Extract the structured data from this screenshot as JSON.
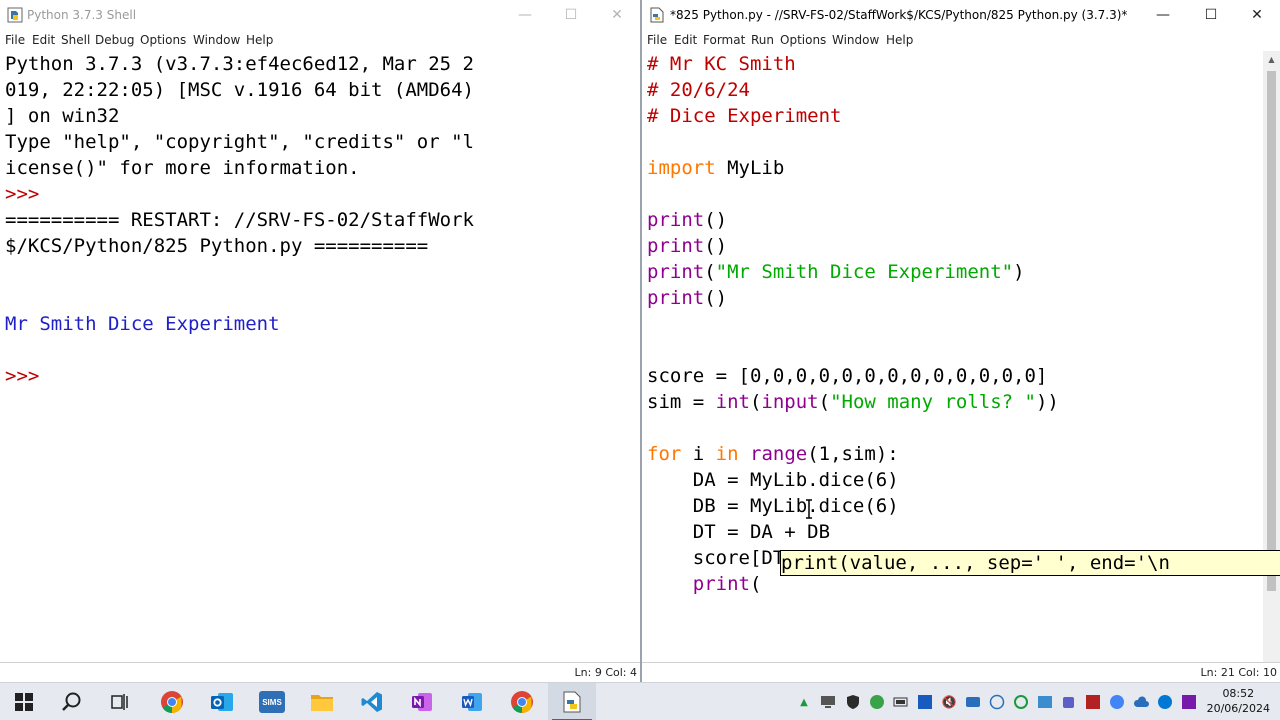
{
  "shell": {
    "title": "Python 3.7.3 Shell",
    "menu": [
      "File",
      "Edit",
      "Shell",
      "Debug",
      "Options",
      "Window",
      "Help"
    ],
    "lines": [
      {
        "text": "Python 3.7.3 (v3.7.3:ef4ec6ed12, Mar 25 2",
        "color": "black"
      },
      {
        "text": "019, 22:22:05) [MSC v.1916 64 bit (AMD64)",
        "color": "black"
      },
      {
        "text": "] on win32",
        "color": "black"
      },
      {
        "text": "Type \"help\", \"copyright\", \"credits\" or \"l",
        "color": "black"
      },
      {
        "text": "icense()\" for more information.",
        "color": "black"
      },
      {
        "text": ">>> ",
        "color": "red"
      },
      {
        "text": "========== RESTART: //SRV-FS-02/StaffWork",
        "color": "black"
      },
      {
        "text": "$/KCS/Python/825 Python.py ==========",
        "color": "black"
      },
      {
        "text": "",
        "color": "black"
      },
      {
        "text": "",
        "color": "black"
      },
      {
        "text": "Mr Smith Dice Experiment",
        "color": "blue"
      },
      {
        "text": "",
        "color": "black"
      },
      {
        "text": ">>> ",
        "color": "red"
      }
    ],
    "status": "Ln: 9  Col: 4"
  },
  "editor": {
    "title": "*825 Python.py - //SRV-FS-02/StaffWork$/KCS/Python/825 Python.py (3.7.3)*",
    "menu": [
      "File",
      "Edit",
      "Format",
      "Run",
      "Options",
      "Window",
      "Help"
    ],
    "lines": [
      [
        {
          "t": "# Mr KC Smith",
          "c": "red"
        }
      ],
      [
        {
          "t": "# 20/6/24",
          "c": "red"
        }
      ],
      [
        {
          "t": "# Dice Experiment",
          "c": "red"
        }
      ],
      [],
      [
        {
          "t": "import",
          "c": "orange"
        },
        {
          "t": " MyLib",
          "c": "black"
        }
      ],
      [],
      [
        {
          "t": "print",
          "c": "purple"
        },
        {
          "t": "()",
          "c": "black"
        }
      ],
      [
        {
          "t": "print",
          "c": "purple"
        },
        {
          "t": "()",
          "c": "black"
        }
      ],
      [
        {
          "t": "print",
          "c": "purple"
        },
        {
          "t": "(",
          "c": "black"
        },
        {
          "t": "\"Mr Smith Dice Experiment\"",
          "c": "green"
        },
        {
          "t": ")",
          "c": "black"
        }
      ],
      [
        {
          "t": "print",
          "c": "purple"
        },
        {
          "t": "()",
          "c": "black"
        }
      ],
      [],
      [],
      [
        {
          "t": "score = [0,0,0,0,0,0,0,0,0,0,0,0,0]",
          "c": "black"
        }
      ],
      [
        {
          "t": "sim = ",
          "c": "black"
        },
        {
          "t": "int",
          "c": "purple"
        },
        {
          "t": "(",
          "c": "black"
        },
        {
          "t": "input",
          "c": "purple"
        },
        {
          "t": "(",
          "c": "black"
        },
        {
          "t": "\"How many rolls? \"",
          "c": "green"
        },
        {
          "t": "))",
          "c": "black"
        }
      ],
      [],
      [
        {
          "t": "for",
          "c": "orange"
        },
        {
          "t": " i ",
          "c": "black"
        },
        {
          "t": "in",
          "c": "orange"
        },
        {
          "t": " ",
          "c": "black"
        },
        {
          "t": "range",
          "c": "purple"
        },
        {
          "t": "(1,sim):",
          "c": "black"
        }
      ],
      [
        {
          "t": "    DA = MyLib.dice(6)",
          "c": "black"
        }
      ],
      [
        {
          "t": "    DB = MyLib.dice(6)",
          "c": "black"
        }
      ],
      [
        {
          "t": "    DT = DA + DB",
          "c": "black"
        }
      ],
      [
        {
          "t": "    score[DT] = score[DT]+1",
          "c": "black"
        }
      ],
      [
        {
          "t": "    ",
          "c": "black"
        },
        {
          "t": "print",
          "c": "purple"
        },
        {
          "t": "(",
          "c": "black"
        }
      ]
    ],
    "calltip": "print(value, ..., sep=' ', end='\\n",
    "status": "Ln: 21  Col: 10"
  },
  "taskbar": {
    "apps": [
      "start-icon",
      "search-icon",
      "task-view-icon",
      "chrome-icon",
      "outlook-icon",
      "sims-icon",
      "file-explorer-icon",
      "vscode-icon",
      "onenote-icon",
      "word-icon",
      "chrome-alt-icon",
      "idle-editor-icon"
    ],
    "sims_label": "SIMS",
    "clock_time": "08:52",
    "clock_date": "20/06/2024"
  },
  "colors": {
    "keyword": "#ff7700",
    "builtin": "#900090",
    "string": "#00aa00",
    "comment": "#c00000",
    "output": "#2020c8",
    "taskbar_bg": "#e6eaf0"
  }
}
